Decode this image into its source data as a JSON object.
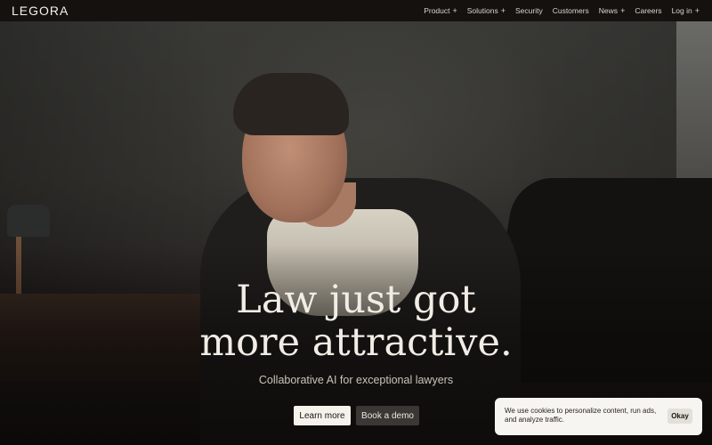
{
  "header": {
    "logo": "LEGORA",
    "nav": [
      {
        "label": "Product",
        "icon": "+"
      },
      {
        "label": "Solutions",
        "icon": "+"
      },
      {
        "label": "Security",
        "icon": ""
      },
      {
        "label": "Customers",
        "icon": ""
      },
      {
        "label": "News",
        "icon": "+"
      },
      {
        "label": "Careers",
        "icon": ""
      },
      {
        "label": "Log in",
        "icon": "+"
      }
    ]
  },
  "hero": {
    "headline_line1": "Law just got",
    "headline_line2": "more attractive.",
    "subtitle": "Collaborative AI for exceptional lawyers",
    "primary_cta": "Learn more",
    "secondary_cta": "Book a demo",
    "image": "hero-portrait-man-in-dark-suit"
  },
  "cookie_banner": {
    "text": "We use cookies to personalize content, run ads, and analyze traffic.",
    "button": "Okay"
  },
  "colors": {
    "nav_bg": "#15110f",
    "primary_button_bg": "#f5f2ec",
    "secondary_button_bg": "#3a3734",
    "cookie_bg": "#f7f5f1"
  }
}
